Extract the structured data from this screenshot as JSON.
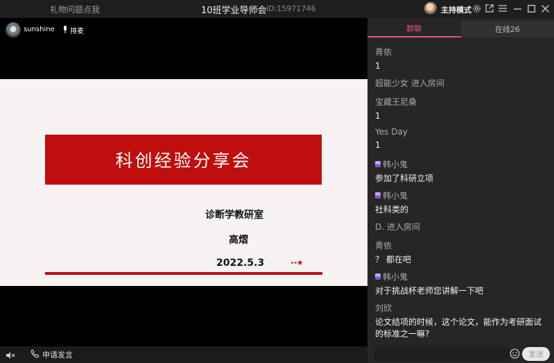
{
  "titlebar": {
    "gift_hint": "礼物问题点我",
    "title": "10班学业导师会",
    "room_id": "ID:15971746",
    "mode_label": "主持模式"
  },
  "stage": {
    "host_name": "sunshine",
    "mic_queue_label": "排麦"
  },
  "slide": {
    "title": "科创经验分享会",
    "department": "诊断学教研室",
    "presenter": "高熠",
    "date": "2022.5.3",
    "decoration": "⋆⋆★"
  },
  "bottom": {
    "apply_speak_label": "申请发言"
  },
  "panel": {
    "tabs": [
      {
        "label": "群聊",
        "active": true
      },
      {
        "label": "在线26",
        "active": false
      }
    ],
    "messages": [
      {
        "name": "青依",
        "text": "1",
        "badge": false
      },
      {
        "name": "超能少女 进入房间",
        "text": "",
        "badge": false
      },
      {
        "name": "宝藏王尼桑",
        "text": "1",
        "badge": false
      },
      {
        "name": "Yes Day",
        "text": "1",
        "badge": false
      },
      {
        "name": "韩小鬼",
        "text": "参加了科研立项",
        "badge": true
      },
      {
        "name": "韩小鬼",
        "text": "社科类的",
        "badge": true
      },
      {
        "name": "D. 进入房间",
        "text": "",
        "badge": false
      },
      {
        "name": "青依",
        "text": "？ 都在吧",
        "badge": false
      },
      {
        "name": "韩小鬼",
        "text": "对于挑战杯老师您讲解一下吧",
        "badge": true
      },
      {
        "name": "刘欣",
        "text": "论文结项的时候，这个论文，能作为考研面试的标准之一嘛?",
        "badge": false
      }
    ],
    "input_placeholder": "",
    "send_label": "发送"
  },
  "colors": {
    "accent": "#e05a6a",
    "slide_red": "#c00d0d",
    "panel_bg": "#262626"
  }
}
